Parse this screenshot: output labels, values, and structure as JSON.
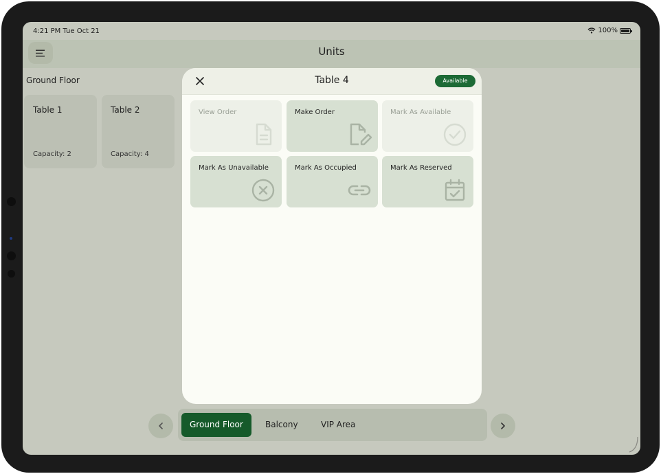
{
  "status_bar": {
    "time": "4:21 PM  Tue Oct 21",
    "battery": "100%"
  },
  "header": {
    "title": "Units",
    "menu_icon": "hamburger-menu-icon"
  },
  "floor": {
    "label": "Ground Floor",
    "tables": [
      {
        "name": "Table 1",
        "capacity": "Capacity: 2"
      },
      {
        "name": "Table 2",
        "capacity": "Capacity: 4"
      }
    ]
  },
  "floor_tabs": {
    "prev_icon": "chevron-left-icon",
    "next_icon": "chevron-right-icon",
    "items": [
      {
        "label": "Ground Floor",
        "active": true
      },
      {
        "label": "Balcony",
        "active": false
      },
      {
        "label": "VIP Area",
        "active": false
      }
    ]
  },
  "modal": {
    "title": "Table 4",
    "status": "Available",
    "close_icon": "close-icon",
    "actions": [
      {
        "label": "View Order",
        "enabled": false,
        "icon": "document-icon"
      },
      {
        "label": "Make Order",
        "enabled": true,
        "icon": "edit-document-icon"
      },
      {
        "label": "Mark As Available",
        "enabled": false,
        "icon": "check-circle-icon"
      },
      {
        "label": "Mark As Unavailable",
        "enabled": true,
        "icon": "x-circle-icon"
      },
      {
        "label": "Mark As Occupied",
        "enabled": true,
        "icon": "link-icon"
      },
      {
        "label": "Mark As Reserved",
        "enabled": true,
        "icon": "calendar-check-icon"
      }
    ]
  },
  "colors": {
    "accent_green": "#155a2a",
    "badge_green": "#1c6a35",
    "action_enabled_bg": "#d7e0d2",
    "action_disabled_bg": "#edf0e8",
    "overlay_bg": "#c6c9be"
  }
}
